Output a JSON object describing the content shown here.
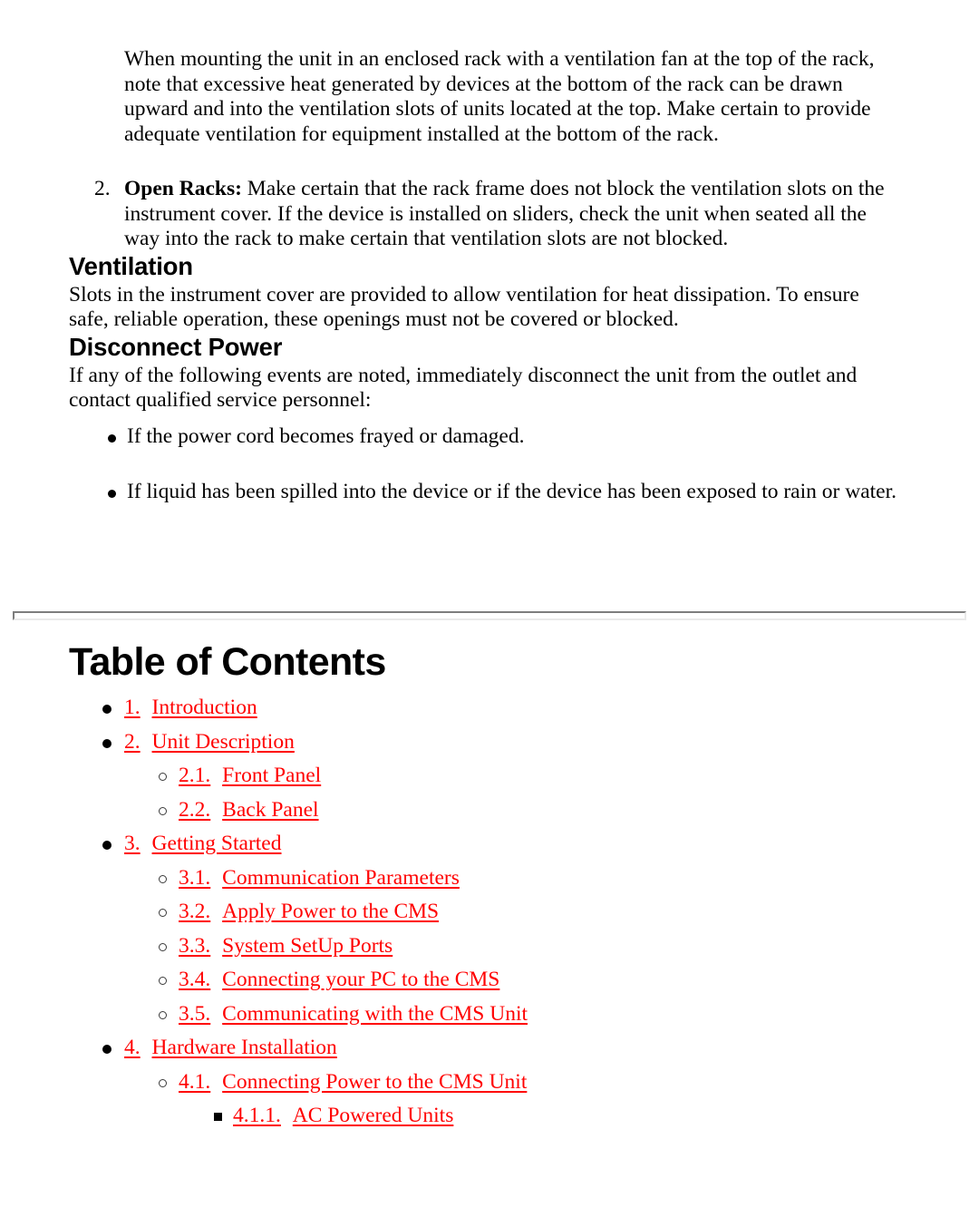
{
  "safety": {
    "intro_paragraph": "When mounting the unit in an enclosed rack with a ventilation fan at the top of the rack, note that excessive heat generated by devices at the bottom of the rack can be drawn upward and into the ventilation slots of units located at the top. Make certain to provide adequate ventilation for equipment installed at the bottom of the rack.",
    "numbered_items": [
      {
        "number": "2.",
        "lead_in": "Open Racks:",
        "text": " Make certain that the rack frame does not block the ventilation slots on the instrument cover. If the device is installed on sliders, check the unit when seated all the way into the rack to make certain that ventilation slots are not blocked."
      }
    ],
    "ventilation": {
      "heading": "Ventilation",
      "paragraph": "Slots in the instrument cover are provided to allow ventilation for heat dissipation. To ensure safe, reliable operation, these openings must not be covered or blocked."
    },
    "disconnect_power": {
      "heading": "Disconnect Power",
      "paragraph": "If any of the following events are noted, immediately disconnect the unit from the outlet and contact qualified service personnel:",
      "bullets": [
        "If the power cord becomes frayed or damaged.",
        "If liquid has been spilled into the device or if the device has been exposed to rain or water."
      ]
    }
  },
  "table_of_contents": {
    "title": "Table of Contents",
    "link_color": "#ff0000",
    "entries": [
      {
        "level": 1,
        "number": "1.",
        "label": "Introduction"
      },
      {
        "level": 1,
        "number": "2.",
        "label": "Unit Description"
      },
      {
        "level": 2,
        "number": "2.1.",
        "label": "Front Panel"
      },
      {
        "level": 2,
        "number": "2.2.",
        "label": "Back Panel"
      },
      {
        "level": 1,
        "number": "3.",
        "label": "Getting Started"
      },
      {
        "level": 2,
        "number": "3.1.",
        "label": "Communication Parameters"
      },
      {
        "level": 2,
        "number": "3.2.",
        "label": "Apply Power to the CMS"
      },
      {
        "level": 2,
        "number": "3.3.",
        "label": "System SetUp Ports"
      },
      {
        "level": 2,
        "number": "3.4.",
        "label": "Connecting your PC to the CMS"
      },
      {
        "level": 2,
        "number": "3.5.",
        "label": "Communicating with the CMS Unit"
      },
      {
        "level": 1,
        "number": "4.",
        "label": "Hardware Installation"
      },
      {
        "level": 2,
        "number": "4.1.",
        "label": "Connecting Power to the CMS Unit"
      },
      {
        "level": 3,
        "number": "4.1.1.",
        "label": "AC Powered Units"
      }
    ]
  }
}
